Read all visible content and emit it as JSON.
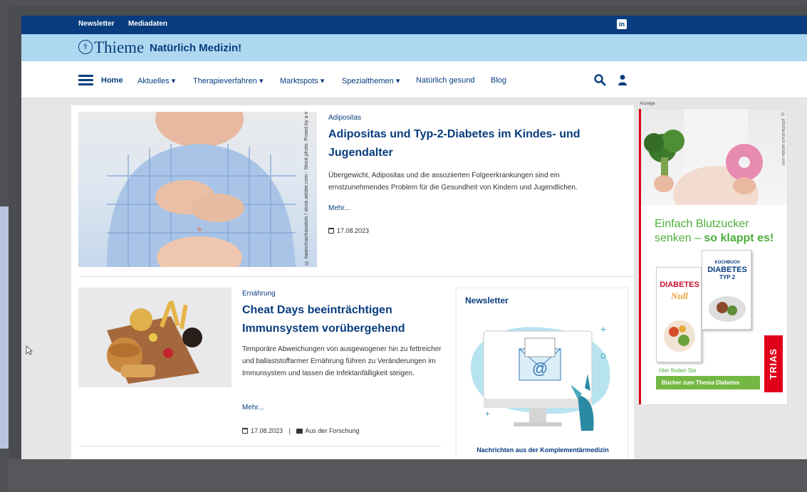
{
  "topbar": {
    "links": [
      "Newsletter",
      "Mediadaten"
    ],
    "social_icon": "linkedin-icon",
    "social_text": "in"
  },
  "brand": {
    "name": "Thieme",
    "tagline": "Natürlich Medizin!"
  },
  "nav": {
    "home": "Home",
    "items": [
      "Aktuelles ▾",
      "Therapieverfahren ▾",
      "Marktspots ▾",
      "Spezialthemen ▾",
      "Natürlich gesund",
      "Blog"
    ],
    "icons": [
      "hamburger-menu-icon",
      "search-icon",
      "user-icon"
    ]
  },
  "articles": [
    {
      "category": "Adipositas",
      "title": "Adipositas und Typ-2-Diabetes im Kindes- und Jugendalter",
      "text": "Übergewicht, Adipositas und die assoziierten Folgeerkrankungen sind ein ernstzunehmendes Problem für die Gesundheit von Kindern und Jugendlichen.",
      "more": "Mehr...",
      "date": "17.08.2023",
      "image_credit": "© kwanchaichaiudom / stock.adobe.com - Stock photo. Posed by a model"
    },
    {
      "category": "Ernährung",
      "title": "Cheat Days beeinträchtigen Immunsystem vorübergehend",
      "text": "Temporäre Abweichungen von ausgewogener hin zu fettreicher und ballaststoffarmer Ernährung führen zu Veränderungen im Immunsystem und lassen die Infektanfälligkeit steigen.",
      "more": "Mehr...",
      "date": "17.08.2023",
      "separator": "|",
      "tag": "Aus der Forschung"
    }
  ],
  "newsletter": {
    "title": "Newsletter",
    "caption": "Nachrichten aus der Komplementärmedizin"
  },
  "ad": {
    "label": "Anzeige",
    "credit": "© jchizhe/stock.adobe.com",
    "headline_line1": "Einfach Blutzucker",
    "headline_line2_normal": "senken – ",
    "headline_line2_bold": "so klappt es!",
    "book1_title": "DIABETES",
    "book1_script": "Null",
    "book2_kicker": "KOCHBUCH",
    "book2_title": "DIABETES",
    "book2_sub": "TYP 2",
    "publisher": "TRIAS",
    "sub": "Hier finden Sie",
    "button": "Bücher zum Thema Diabetes"
  }
}
